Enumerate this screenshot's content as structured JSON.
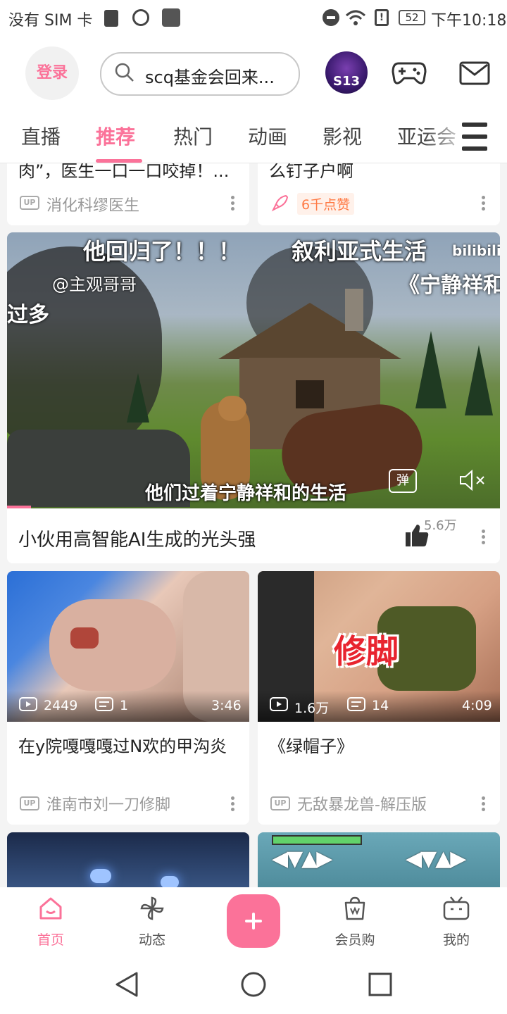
{
  "status_bar": {
    "carrier": "没有 SIM 卡",
    "battery": "52",
    "time": "下午10:18"
  },
  "header": {
    "login_label": "登录",
    "search_text": "scq基金会回来...",
    "event_badge": "S13",
    "icons": [
      "search-icon",
      "gamepad-icon",
      "mail-icon",
      "menu-icon"
    ]
  },
  "tabs": [
    {
      "label": "直播"
    },
    {
      "label": "推荐",
      "active": true
    },
    {
      "label": "热门"
    },
    {
      "label": "动画"
    },
    {
      "label": "影视"
    },
    {
      "label": "亚运会"
    }
  ],
  "feed": {
    "top_left": {
      "title_fragment": "肉”，医生一口一口咬掉！...",
      "author": "消化科缪医生"
    },
    "top_right": {
      "title_fragment": "么钉子户啊",
      "badge": "6千点赞"
    },
    "featured": {
      "overlay_top_left": "他回归了！！！",
      "overlay_top_right": "叙利亚式生活",
      "overlay_quote": "《宁静祥和",
      "overlay_watermark": "@主观哥哥",
      "overlay_left_edge": "过多",
      "overlay_brand": "bilibili",
      "subtitle": "他们过着宁静祥和的生活",
      "danmaku_label": "弹",
      "title": "小伙用高智能AI生成的光头强",
      "likes": "5.6万"
    },
    "cards": [
      {
        "plays": "2449",
        "comments": "1",
        "duration": "3:46",
        "title": "在y院嘎嘎嘎过N欢的甲沟炎",
        "author": "淮南市刘一刀修脚"
      },
      {
        "thumb_text": "修脚",
        "plays": "1.6万",
        "comments": "14",
        "duration": "4:09",
        "title": "《绿帽子》",
        "author": "无敌暴龙兽-解压版"
      }
    ]
  },
  "bottom_nav": [
    {
      "label": "首页",
      "active": true
    },
    {
      "label": "动态"
    },
    {
      "label": ""
    },
    {
      "label": "会员购"
    },
    {
      "label": "我的"
    }
  ],
  "colors": {
    "accent": "#fb7299",
    "background": "#f4f4f4"
  }
}
